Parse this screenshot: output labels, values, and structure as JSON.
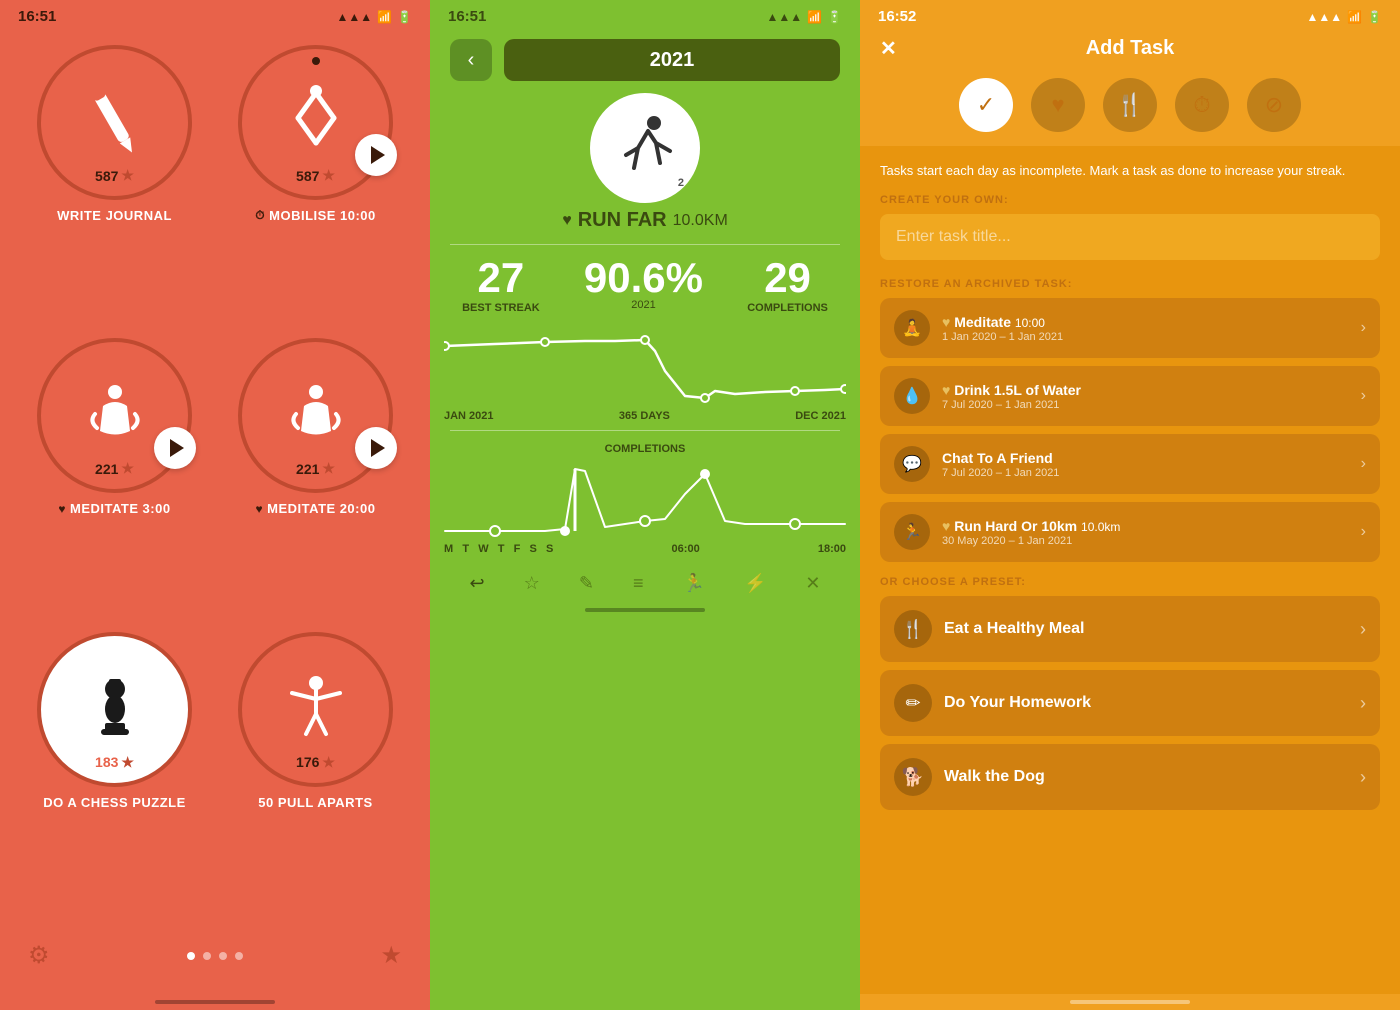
{
  "panel1": {
    "status_time": "16:51",
    "tasks": [
      {
        "name": "WRITE JOURNAL",
        "badge": "587",
        "has_dot": false,
        "has_play": false,
        "icon_type": "pen",
        "white_bg": false,
        "heart": false,
        "clock": false
      },
      {
        "name": "MOBILISE",
        "time": "10:00",
        "badge": "587",
        "has_dot": true,
        "has_play": true,
        "icon_type": "mobilise",
        "white_bg": false,
        "heart": false,
        "clock": true
      },
      {
        "name": "MEDITATE",
        "time": "3:00",
        "badge": "221",
        "has_dot": false,
        "has_play": true,
        "icon_type": "meditate",
        "white_bg": false,
        "heart": true,
        "clock": false
      },
      {
        "name": "MEDITATE",
        "time": "20:00",
        "badge": "221",
        "has_dot": false,
        "has_play": true,
        "icon_type": "meditate",
        "white_bg": false,
        "heart": true,
        "clock": false
      },
      {
        "name": "DO A CHESS PUZZLE",
        "badge": "183",
        "has_dot": false,
        "has_play": false,
        "icon_type": "chess",
        "white_bg": true,
        "heart": false,
        "clock": false
      },
      {
        "name": "50 PULL APARTS",
        "badge": "176",
        "has_dot": false,
        "has_play": false,
        "icon_type": "pullapart",
        "white_bg": false,
        "heart": false,
        "clock": false
      }
    ],
    "bottom": {
      "page_dots": [
        true,
        false,
        false,
        false
      ],
      "gear": "⚙",
      "star": "★"
    }
  },
  "panel2": {
    "status_time": "16:51",
    "year": "2021",
    "activity_label": "RUN FAR",
    "activity_km": "10.0KM",
    "circle_num": "2",
    "stats": {
      "best_streak_num": "27",
      "best_streak_label": "BEST STREAK",
      "pct_num": "90.6%",
      "pct_label": "2021",
      "completions_num": "29",
      "completions_label": "COMPLETIONS"
    },
    "axis": {
      "left": "JAN 2021",
      "mid": "365 DAYS",
      "right": "DEC 2021"
    },
    "axis2": {
      "left": "06:00",
      "right": "18:00"
    },
    "completions_label": "COMPLETIONS",
    "weekdays": [
      "M",
      "T",
      "W",
      "T",
      "F",
      "S",
      "S"
    ],
    "bottom_icons": [
      "↩",
      "★",
      "✎",
      "≡",
      "🏃",
      "⚡",
      "✕"
    ]
  },
  "panel3": {
    "status_time": "16:52",
    "title": "Add Task",
    "hint": "Tasks start each day as incomplete. Mark a task as done to increase your streak.",
    "create_label": "CREATE YOUR OWN:",
    "input_placeholder": "Enter task title...",
    "restore_label": "RESTORE AN ARCHIVED TASK:",
    "archived": [
      {
        "name": "Meditate",
        "time": "10:00",
        "date": "1 Jan 2020 – 1 Jan 2021",
        "heart": true,
        "icon": "🧘"
      },
      {
        "name": "Drink 1.5L of Water",
        "date": "7 Jul 2020 – 1 Jan 2021",
        "heart": true,
        "icon": "💧"
      },
      {
        "name": "Chat To A Friend",
        "date": "7 Jul 2020 – 1 Jan 2021",
        "heart": false,
        "icon": "💬"
      },
      {
        "name": "Run Hard Or 10km",
        "km": "10.0km",
        "date": "30 May 2020 – 1 Jan 2021",
        "heart": true,
        "icon": "🏃"
      }
    ],
    "preset_label": "OR CHOOSE A PRESET:",
    "presets": [
      {
        "name": "Eat a Healthy Meal",
        "icon": "🍴"
      },
      {
        "name": "Do Your Homework",
        "icon": "✏"
      },
      {
        "name": "Walk the Dog",
        "icon": "🐕"
      }
    ]
  }
}
